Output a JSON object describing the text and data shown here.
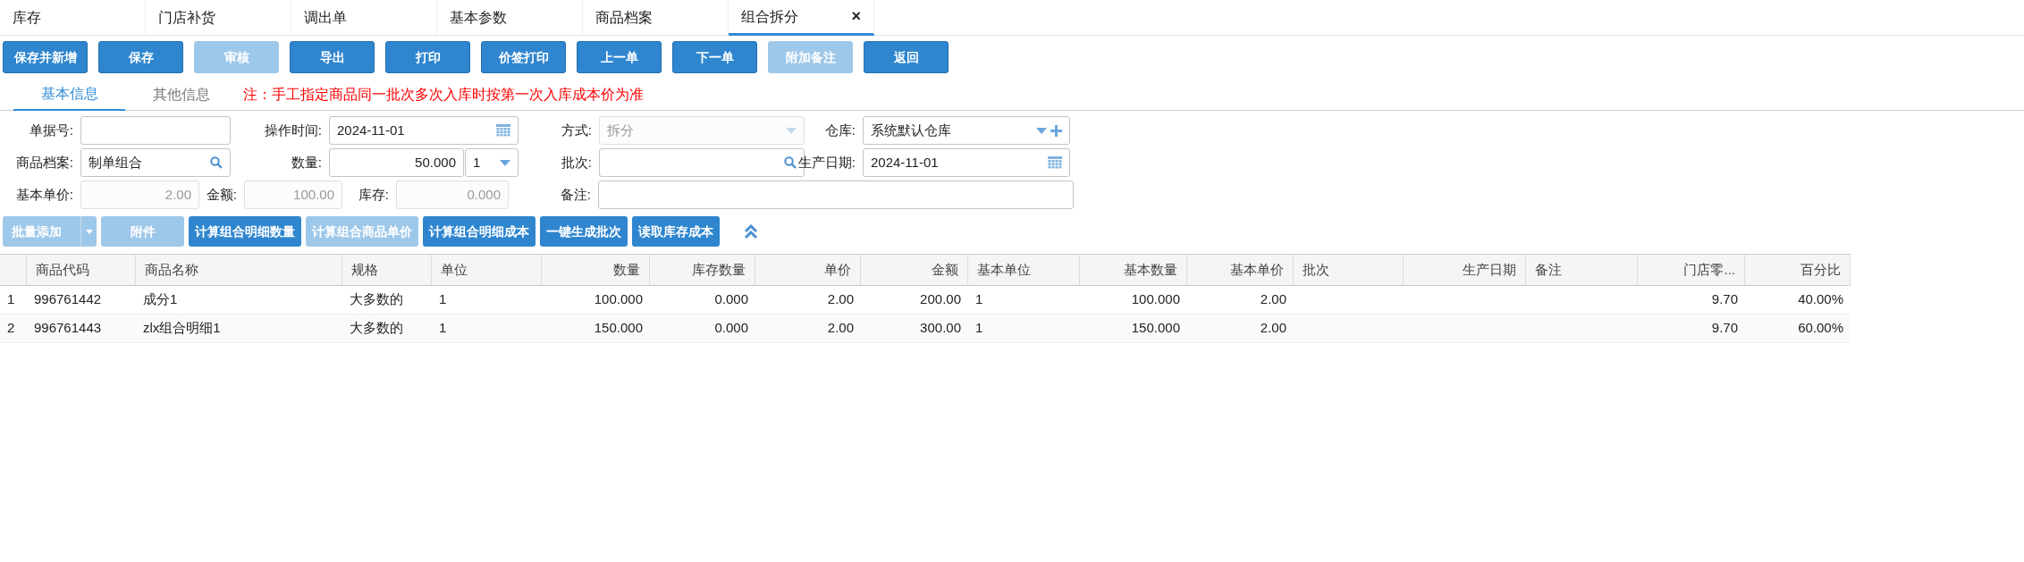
{
  "tabs": [
    {
      "label": "库存",
      "selected": false
    },
    {
      "label": "门店补货",
      "selected": false
    },
    {
      "label": "调出单",
      "selected": false
    },
    {
      "label": "基本参数",
      "selected": false
    },
    {
      "label": "商品档案",
      "selected": false
    },
    {
      "label": "组合拆分",
      "selected": true,
      "close_glyph": "×"
    }
  ],
  "toolbar": [
    {
      "label": "保存并新增",
      "disabled": false
    },
    {
      "label": "保存",
      "disabled": false
    },
    {
      "label": "审核",
      "disabled": true
    },
    {
      "label": "导出",
      "disabled": false
    },
    {
      "label": "打印",
      "disabled": false
    },
    {
      "label": "价签打印",
      "disabled": false
    },
    {
      "label": "上一单",
      "disabled": false
    },
    {
      "label": "下一单",
      "disabled": false
    },
    {
      "label": "附加备注",
      "disabled": true
    },
    {
      "label": "返回",
      "disabled": false
    }
  ],
  "subtabs": [
    {
      "label": "基本信息",
      "selected": true
    },
    {
      "label": "其他信息",
      "selected": false
    }
  ],
  "notice": "注：手工指定商品同一批次多次入库时按第一次入库成本价为准",
  "form_rows": [
    [
      {
        "label": "单据号:",
        "kind": "text",
        "disabled": false
      },
      {
        "label": "操作时间:",
        "kind": "date",
        "value": "2024-11-01",
        "disabled": false
      },
      {
        "label": "方式:",
        "kind": "select",
        "value": "拆分",
        "disabled": true
      },
      {
        "label": "仓库:",
        "kind": "select_add",
        "value": "系统默认仓库",
        "disabled": false
      }
    ],
    [
      {
        "label": "商品档案:",
        "kind": "search",
        "value": "制单组合",
        "disabled": false
      },
      {
        "label": "数量:",
        "kind": "number_unit",
        "value": "50.000",
        "unit": "1",
        "disabled": false
      },
      {
        "label": "批次:",
        "kind": "search",
        "disabled": false
      },
      {
        "label": "生产日期:",
        "kind": "date",
        "value": "2024-11-01",
        "disabled": false
      }
    ],
    [
      {
        "label": "基本单价:",
        "kind": "number",
        "value": "2.00",
        "disabled": true
      },
      {
        "label": "金额:",
        "kind": "number",
        "value": "100.00",
        "disabled": true
      },
      {
        "label": "库存:",
        "kind": "number",
        "value": "0.000",
        "disabled": true
      },
      {
        "label": "备注:",
        "kind": "text",
        "disabled": false
      }
    ]
  ],
  "actions": [
    {
      "label": "批量添加",
      "kind": "split",
      "disabled": true
    },
    {
      "label": "附件",
      "kind": "plain",
      "disabled": true
    },
    {
      "label": "计算组合明细数量",
      "kind": "plain",
      "disabled": false
    },
    {
      "label": "计算组合商品单价",
      "kind": "plain",
      "disabled": true
    },
    {
      "label": "计算组合明细成本",
      "kind": "plain",
      "disabled": false
    },
    {
      "label": "一键生成批次",
      "kind": "plain",
      "disabled": false
    },
    {
      "label": "读取库存成本",
      "kind": "plain",
      "disabled": false
    }
  ],
  "table": {
    "columns": [
      {
        "label": "商品代码",
        "numeric": false
      },
      {
        "label": "商品名称",
        "numeric": false
      },
      {
        "label": "规格",
        "numeric": false
      },
      {
        "label": "单位",
        "numeric": false
      },
      {
        "label": "数量",
        "numeric": true
      },
      {
        "label": "库存数量",
        "numeric": true
      },
      {
        "label": "单价",
        "numeric": true
      },
      {
        "label": "金额",
        "numeric": true
      },
      {
        "label": "基本单位",
        "numeric": false
      },
      {
        "label": "基本数量",
        "numeric": true
      },
      {
        "label": "基本单价",
        "numeric": true
      },
      {
        "label": "批次",
        "numeric": false
      },
      {
        "label": "生产日期",
        "numeric": true
      },
      {
        "label": "备注",
        "numeric": false
      },
      {
        "label": "门店零...",
        "numeric": true
      },
      {
        "label": "百分比",
        "numeric": true
      }
    ],
    "rows": [
      {
        "row_number": "1",
        "cells": [
          "996761442",
          "成分1",
          "大多数的",
          "1",
          "100.000",
          "0.000",
          "2.00",
          "200.00",
          "1",
          "100.000",
          "2.00",
          "",
          "",
          "",
          "9.70",
          "40.00%"
        ]
      },
      {
        "row_number": "2",
        "cells": [
          "996761443",
          "zlx组合明细1",
          "大多数的",
          "1",
          "150.000",
          "0.000",
          "2.00",
          "300.00",
          "1",
          "150.000",
          "2.00",
          "",
          "",
          "",
          "9.70",
          "60.00%"
        ]
      }
    ]
  }
}
